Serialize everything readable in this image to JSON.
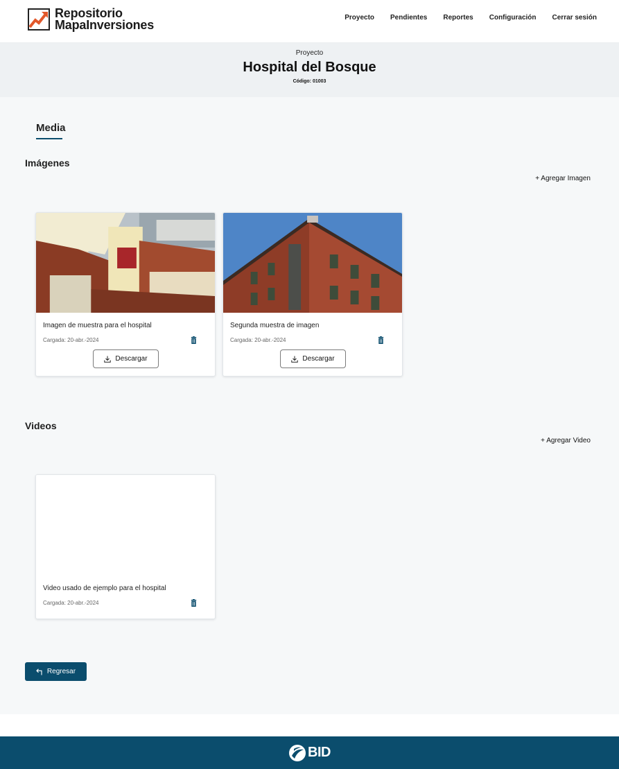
{
  "app": {
    "logo_line1": "Repositorio",
    "logo_line2": "MapaInversiones"
  },
  "nav": [
    {
      "label": "Proyecto"
    },
    {
      "label": "Pendientes"
    },
    {
      "label": "Reportes"
    },
    {
      "label": "Configuración"
    },
    {
      "label": "Cerrar sesión"
    }
  ],
  "project": {
    "eyebrow": "Proyecto",
    "title": "Hospital del Bosque",
    "code": "Código: 01003"
  },
  "tabs": [
    {
      "label": "Media",
      "active": true
    }
  ],
  "images_section": {
    "title": "Imágenes",
    "add_label": "+ Agregar Imagen",
    "items": [
      {
        "caption": "Imagen de muestra para el hospital",
        "date": "Cargada: 20-abr.-2024",
        "download_label": "Descargar"
      },
      {
        "caption": "Segunda muestra de imagen",
        "date": "Cargada: 20-abr.-2024",
        "download_label": "Descargar"
      }
    ]
  },
  "videos_section": {
    "title": "Videos",
    "add_label": "+ Agregar Video",
    "items": [
      {
        "caption": "Video usado de ejemplo para el hospital",
        "date": "Cargada: 20-abr.-2024"
      }
    ]
  },
  "back_label": "Regresar",
  "footer": {
    "brand": "BID"
  },
  "colors": {
    "primary": "#0b4d6d",
    "logo_orange": "#e2582a",
    "banner_bg": "#eef1f3",
    "main_bg": "#f6f8f9"
  },
  "icons": [
    "trending-up-logo-icon",
    "trash-icon",
    "download-icon",
    "return-arrow-icon",
    "bid-logo-icon"
  ]
}
